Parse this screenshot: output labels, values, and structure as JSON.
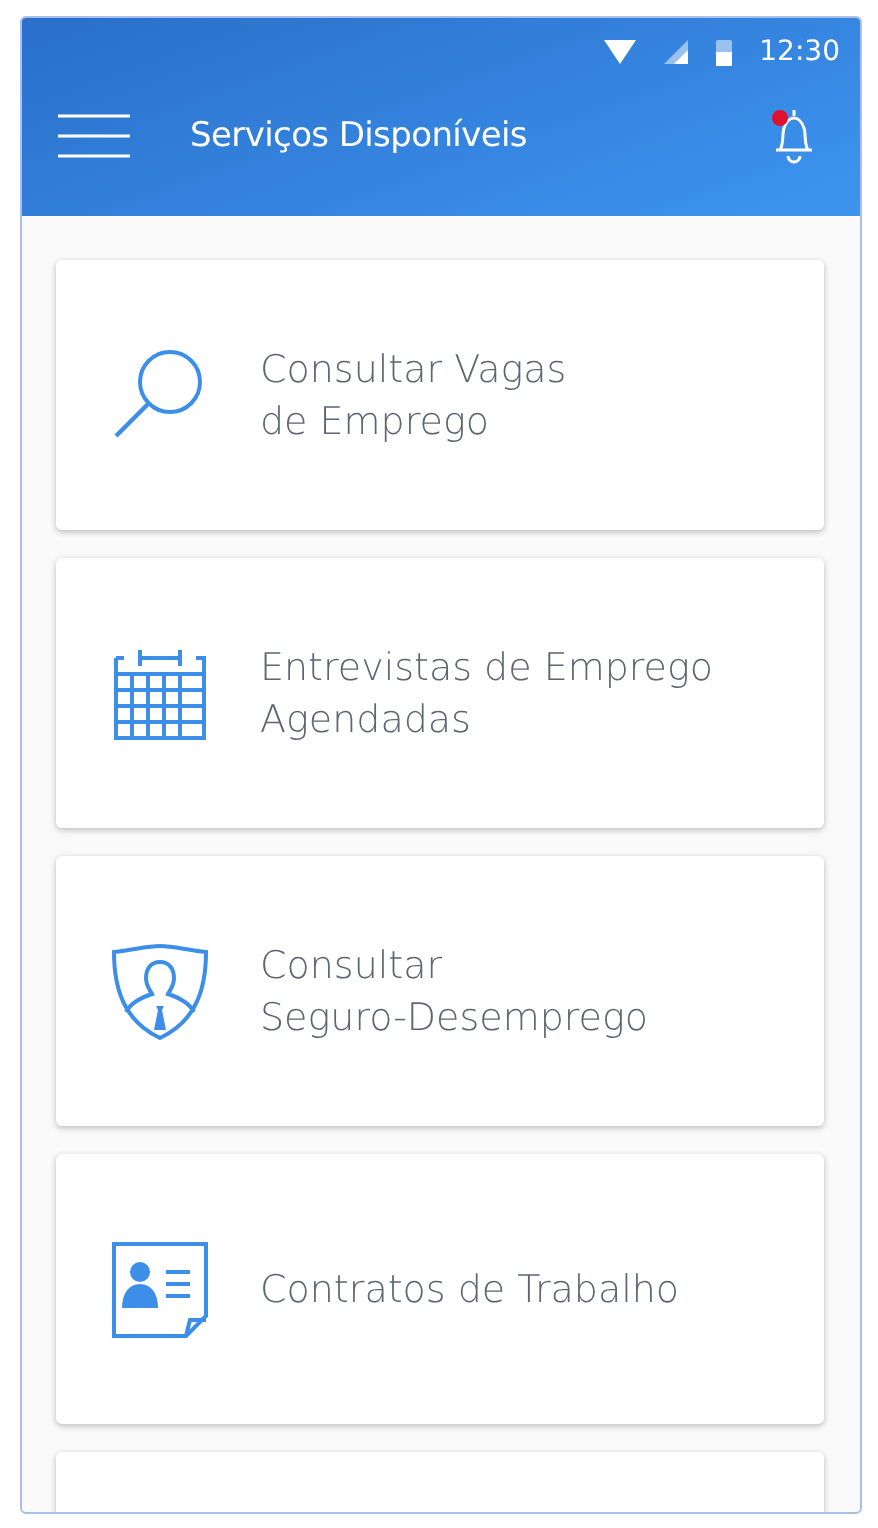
{
  "status_bar": {
    "time": "12:30"
  },
  "app_bar": {
    "title": "Serviços Disponíveis",
    "notification_unread": true
  },
  "services": [
    {
      "kind": "search",
      "lines": [
        "Consultar Vagas",
        "de Emprego"
      ]
    },
    {
      "kind": "calendar",
      "lines": [
        "Entrevistas de Emprego",
        "Agendadas"
      ]
    },
    {
      "kind": "shield",
      "lines": [
        "Consultar",
        "Seguro-Desemprego"
      ]
    },
    {
      "kind": "contract",
      "lines": [
        "Contratos de Trabalho"
      ]
    }
  ]
}
